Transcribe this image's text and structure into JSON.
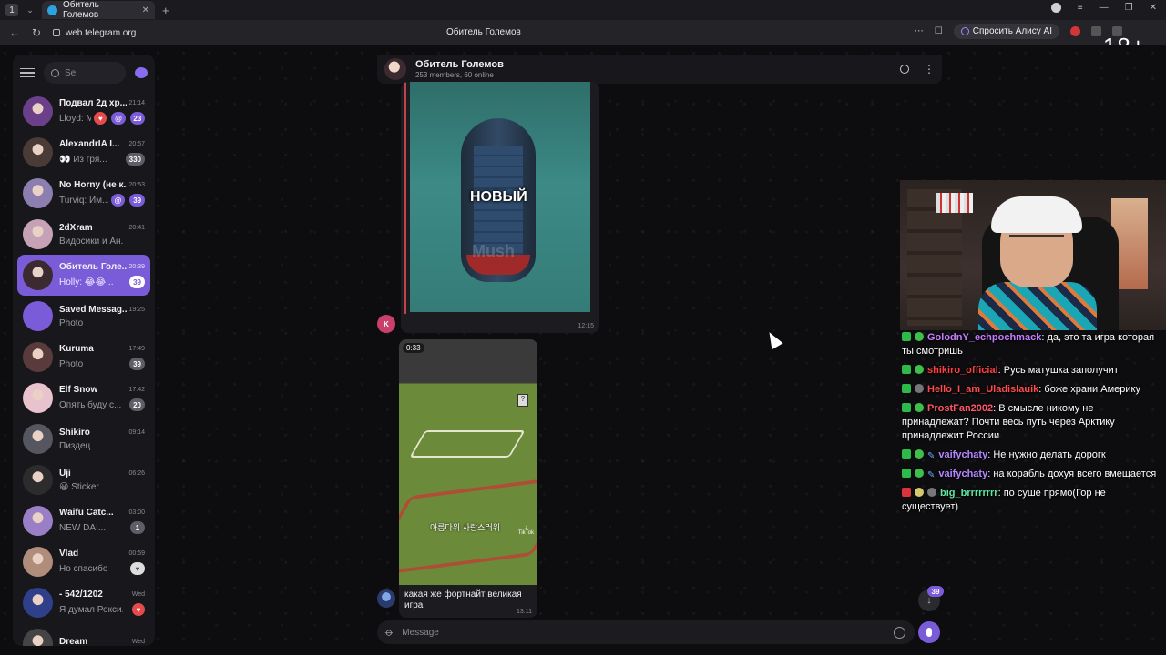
{
  "browser": {
    "tab_title": "Обитель Големов",
    "url": "web.telegram.org",
    "page_title": "Обитель Големов",
    "alice_button": "Спросить Алису AI",
    "age_rating": "18+"
  },
  "sidebar": {
    "search_placeholder": "Se",
    "chats": [
      {
        "name": "Подвал 2д хр...",
        "time": "21:14",
        "preview": "Lloyd: M",
        "badge": "23",
        "avatar": "#6b3f8a"
      },
      {
        "name": "AlexandrIA I...",
        "time": "20:57",
        "preview": "👀 Из гря...",
        "badge": "330",
        "avatar": "#4a3b36"
      },
      {
        "name": "No Horny (не к...",
        "time": "20:53",
        "preview": "Turviq: Им...",
        "badge": "39",
        "avatar": "#8c7fb0"
      },
      {
        "name": "2dXram",
        "time": "20:41",
        "preview": "Видосики и Ан...",
        "badge": "",
        "avatar": "#c6a2b6"
      },
      {
        "name": "Обитель Голе...",
        "time": "20:39",
        "preview": "Holly: 😂😂...",
        "badge": "39",
        "avatar": "#3b2a30"
      },
      {
        "name": "Saved Messag...",
        "time": "19:25",
        "preview": "Photo",
        "badge": "",
        "avatar": "#7a5bd8"
      },
      {
        "name": "Kuruma",
        "time": "17:49",
        "preview": "Photo",
        "badge": "39",
        "avatar": "#5a3b3b"
      },
      {
        "name": "Elf Snow",
        "time": "17:42",
        "preview": "Опять буду с...",
        "badge": "20",
        "avatar": "#e8c2cc"
      },
      {
        "name": "Shikiro",
        "time": "09:14",
        "preview": "Пиздец",
        "badge": "",
        "avatar": "#565660"
      },
      {
        "name": "Uji",
        "time": "06:26",
        "preview": "😀 Sticker",
        "badge": "",
        "avatar": "#2c2c2c"
      },
      {
        "name": "Waifu Catc...",
        "time": "03:00",
        "preview": "NEW DAI...",
        "badge": "1",
        "avatar": "#9a7fc7"
      },
      {
        "name": "Vlad",
        "time": "00:59",
        "preview": "Но спасибо",
        "badge": "",
        "avatar": "#b08c7a"
      },
      {
        "name": "- 542/1202",
        "time": "Wed",
        "preview": "Я думал Рокси...",
        "badge": "",
        "avatar": "#2f3f8a"
      },
      {
        "name": "Dream",
        "time": "Wed",
        "preview": "",
        "badge": "",
        "avatar": "#444"
      }
    ]
  },
  "chat": {
    "title": "Обитель Големов",
    "subtitle": "253 members, 60 online",
    "msg1": {
      "overlay_text": "НОВЫЙ",
      "watermark": "Mush",
      "time": "12:15",
      "sender_initial": "K"
    },
    "msg2": {
      "duration": "0:33",
      "video_text": "아름다워 사랑스러워",
      "tiktok": "TikTok",
      "caption": "какая же фортнайт великая игра",
      "time": "13:11"
    },
    "scroll_badge": "39",
    "composer_placeholder": "Message"
  },
  "stream_chat": [
    {
      "user": "GolodnY_echpochmack",
      "text": "да, это та игра которая ты смотришь"
    },
    {
      "user": "shikiro_official",
      "text": "Русь матушка заполучит"
    },
    {
      "user": "Hello_I_am_Uladislauik",
      "text": "боже храни Америку"
    },
    {
      "user": "ProstFan2002",
      "text": "В смысле никому не принадлежат? Почти весь путь через Арктику принадлежит России"
    },
    {
      "user": "vaifychaty",
      "text": "Не нужно делать дорогк"
    },
    {
      "user": "vaifychaty",
      "text": "на корабль дохуя всего вмещается"
    },
    {
      "user": "big_brrrrrrrr",
      "text": "по суше прямо(Гор не существует)"
    }
  ]
}
